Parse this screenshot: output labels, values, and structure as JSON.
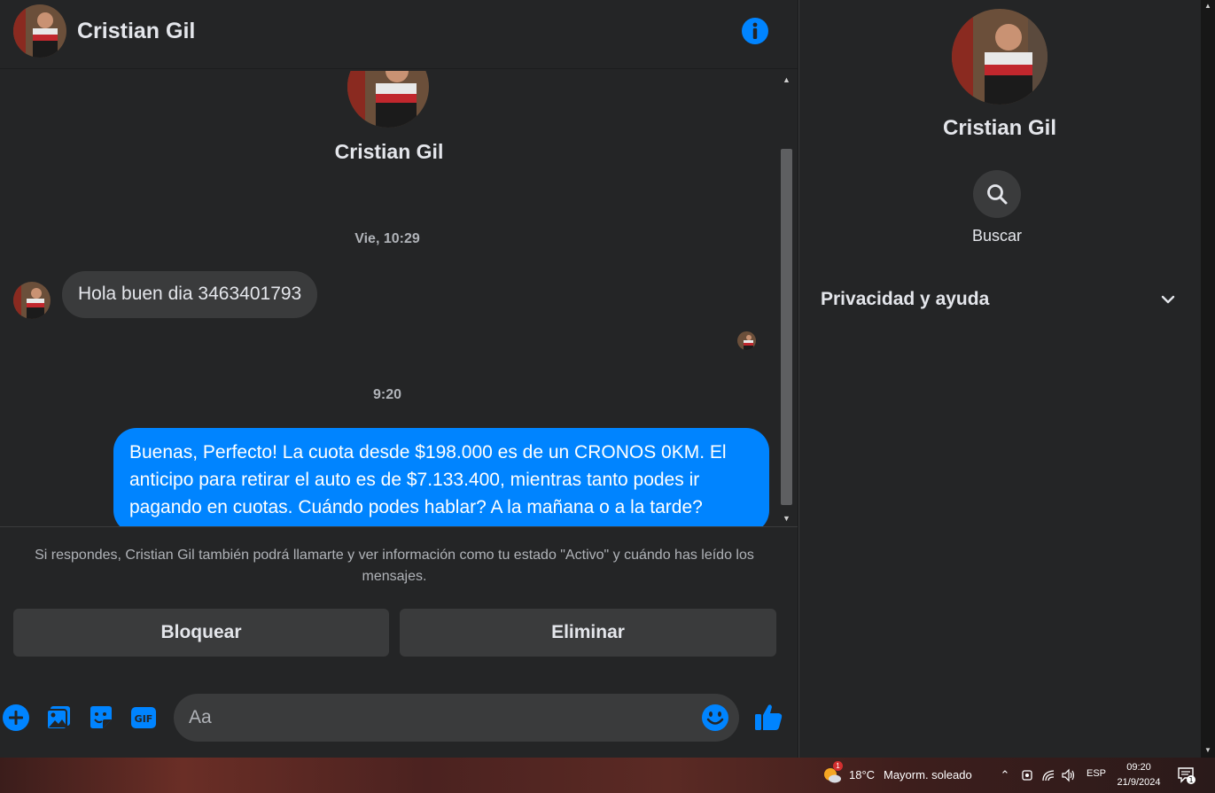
{
  "header": {
    "contact_name": "Cristian Gil"
  },
  "conversation": {
    "profile_name": "Cristian Gil",
    "timestamp_1": "Vie, 10:29",
    "incoming_message": "Hola buen dia 3463401793",
    "timestamp_2": "9:20",
    "outgoing_message": "Buenas, Perfecto! La cuota desde $198.000 es de un CRONOS 0KM. El anticipo para retirar el auto es de $7.133.400, mientras tanto podes ir pagando en cuotas. Cuándo podes hablar? A la mañana o a la tarde?"
  },
  "request_panel": {
    "notice": "Si respondes, Cristian Gil también podrá llamarte y ver información como tu estado \"Activo\" y cuándo has leído los mensajes.",
    "block_label": "Bloquear",
    "delete_label": "Eliminar"
  },
  "composer": {
    "placeholder": "Aa",
    "icons": [
      "plus-icon",
      "photo-icon",
      "sticker-icon",
      "gif-icon",
      "emoji-icon",
      "like-icon"
    ]
  },
  "sidebar": {
    "name": "Cristian Gil",
    "search_label": "Buscar",
    "privacy_label": "Privacidad y ayuda"
  },
  "taskbar": {
    "temperature": "18°C",
    "weather": "Mayorm. soleado",
    "weather_badge": "1",
    "language": "ESP",
    "time": "09:20",
    "date": "21/9/2024",
    "notification_count": "1"
  },
  "colors": {
    "accent": "#0084ff",
    "background": "#242526",
    "bubble_in": "#3a3b3c"
  }
}
